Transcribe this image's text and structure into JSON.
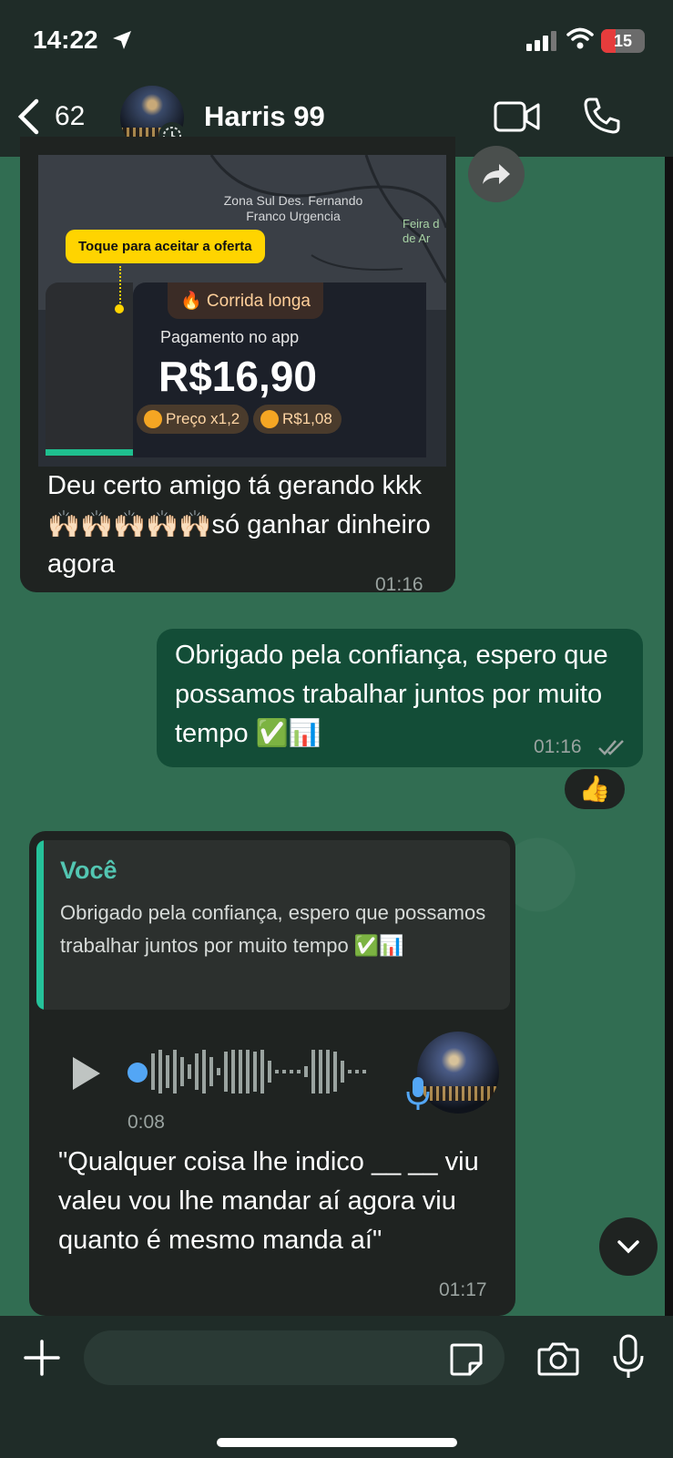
{
  "status": {
    "time": "14:22",
    "battery": "15"
  },
  "header": {
    "back_count": "62",
    "contact_name": "Harris 99"
  },
  "messages": {
    "incoming_image": {
      "map_label": "Zona Sul Des. Fernando Franco Urgencia",
      "map_place": "Feira d de Ar",
      "tooltip": "Toque para aceitar a oferta",
      "chip_long": "🔥 Corrida longa",
      "payment_label": "Pagamento no app",
      "price": "R$16,90",
      "chip_price": "Preço x1,2",
      "chip_bonus": "R$1,08",
      "caption": "Deu certo amigo tá gerando kkk🙌🏻🙌🏻🙌🏻🙌🏻🙌🏻só ganhar dinheiro agora",
      "time": "01:16"
    },
    "outgoing": {
      "text": "Obrigado pela confiança, espero que possamos trabalhar juntos por muito tempo ✅📊",
      "time": "01:16",
      "reaction": "👍"
    },
    "reply": {
      "quote_author": "Você",
      "quote_text": "Obrigado pela confiança, espero que possamos trabalhar juntos por muito tempo ✅📊",
      "voice_duration": "0:08",
      "transcript": "\"Qualquer coisa lhe indico __ __ viu valeu vou lhe mandar aí agora viu quanto é mesmo manda aí\"",
      "time": "01:17"
    }
  },
  "colors": {
    "incoming": "#1f2321",
    "outgoing": "#134d37",
    "accent": "#25c29a"
  }
}
